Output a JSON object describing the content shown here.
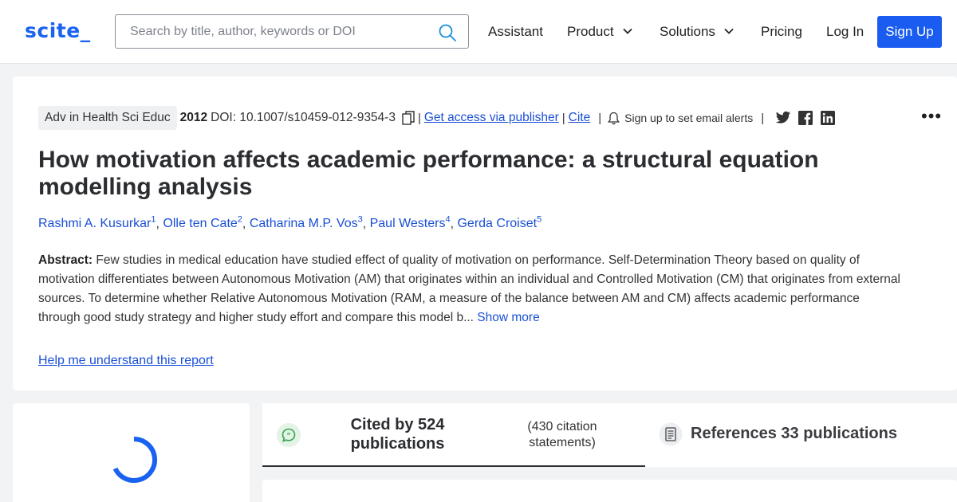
{
  "header": {
    "logo": "scite_",
    "search": {
      "placeholder": "Search by title, author, keywords or DOI",
      "value": ""
    },
    "nav": {
      "assistant": "Assistant",
      "product": "Product",
      "solutions": "Solutions",
      "pricing": "Pricing",
      "login": "Log In",
      "signup": "Sign Up"
    }
  },
  "paper": {
    "journal": "Adv in Health Sci Educ",
    "year": "2012",
    "doi": "DOI: 10.1007/s10459-012-9354-3",
    "access_link": "Get access via publisher",
    "cite_link": "Cite",
    "alerts_text": "Sign up to set email alerts",
    "title": "How motivation affects academic performance: a structural equation modelling analysis",
    "authors": [
      {
        "name": "Rashmi A. Kusurkar",
        "sup": "1"
      },
      {
        "name": "Olle ten Cate",
        "sup": "2"
      },
      {
        "name": "Catharina M.P. Vos",
        "sup": "3"
      },
      {
        "name": "Paul Westers",
        "sup": "4"
      },
      {
        "name": "Gerda Croiset",
        "sup": "5"
      }
    ],
    "abstract_label": "Abstract:",
    "abstract_text": " Few studies in medical education have studied effect of quality of motivation on performance. Self-Determination Theory based on quality of motivation differentiates between Autonomous Motivation (AM) that originates within an individual and Controlled Motivation (CM) that originates from external sources. To determine whether Relative Autonomous Motivation (RAM, a measure of the balance between AM and CM) affects academic performance through good study strategy and higher study effort and compare this model b...",
    "show_more": " Show more",
    "help_link": "Help me understand this report"
  },
  "tabs": {
    "cited": "Cited by 524 publications",
    "cited_sub": "(430 citation statements)",
    "references": "References 33 publications"
  },
  "colors": {
    "brand": "#1a5cf0",
    "link": "#1a4fd6"
  }
}
